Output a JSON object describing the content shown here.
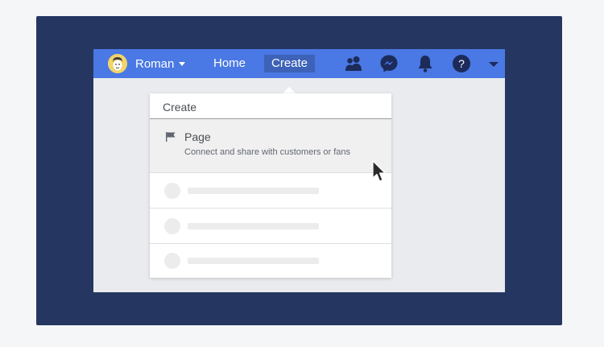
{
  "topbar": {
    "user_name": "Roman",
    "nav": {
      "home": "Home",
      "create": "Create"
    },
    "icons": [
      "friends-icon",
      "messenger-icon",
      "notifications-icon",
      "help-icon",
      "account-menu-icon"
    ]
  },
  "dropdown": {
    "title": "Create",
    "page_item": {
      "label": "Page",
      "description": "Connect and share with customers or fans"
    }
  },
  "colors": {
    "frame_background": "#253761",
    "topbar": "#4a78e4",
    "create_highlight": "#3d62b8",
    "screen_background": "#e9ebee",
    "icon_dark": "#1c2b5a"
  }
}
